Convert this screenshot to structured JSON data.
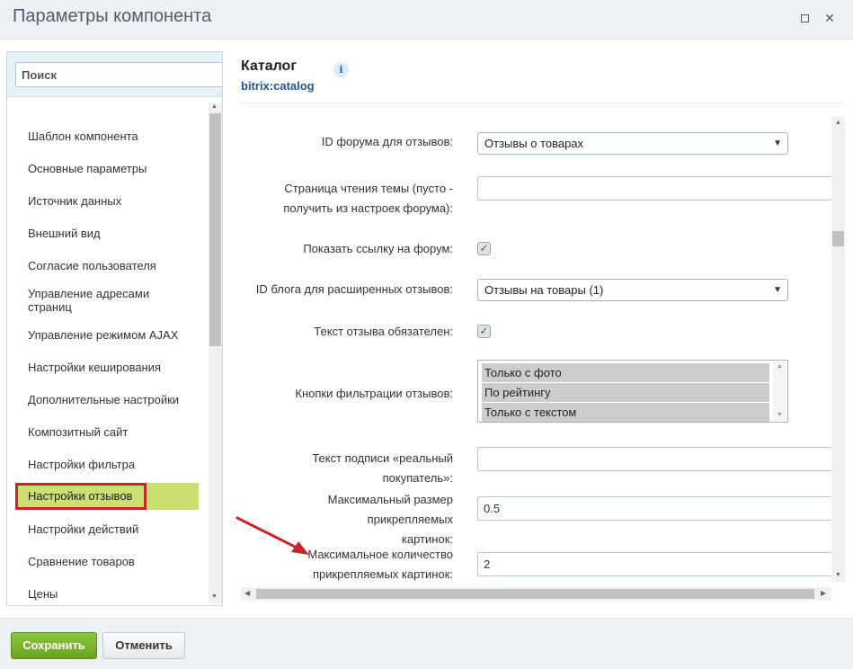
{
  "window": {
    "title": "Параметры компонента",
    "maximize_icon": "maximize-icon",
    "close_icon": "close-icon",
    "close_glyph": "✕"
  },
  "sidebar": {
    "search_placeholder": "Поиск",
    "items": [
      {
        "label": "Шаблон компонента"
      },
      {
        "label": "Основные параметры"
      },
      {
        "label": "Источник данных"
      },
      {
        "label": "Внешний вид"
      },
      {
        "label": "Согласие пользователя"
      },
      {
        "label": "Управление адресами страниц"
      },
      {
        "label": "Управление режимом AJAX"
      },
      {
        "label": "Настройки кеширования"
      },
      {
        "label": "Дополнительные настройки"
      },
      {
        "label": "Композитный сайт"
      },
      {
        "label": "Настройки фильтра"
      },
      {
        "label": "Настройки отзывов"
      },
      {
        "label": "Настройки действий"
      },
      {
        "label": "Сравнение товаров"
      },
      {
        "label": "Цены"
      }
    ],
    "active_index": 11
  },
  "component": {
    "title": "Каталог",
    "code": "bitrix:catalog",
    "info_glyph": "i"
  },
  "form": {
    "forum_id": {
      "label": "ID форума для отзывов:",
      "value": "Отзывы о товарах"
    },
    "topic_page": {
      "label_line1": "Страница чтения темы (пусто -",
      "label_line2": "получить из настроек форума):",
      "value": ""
    },
    "show_forum_link": {
      "label": "Показать ссылку на форум:",
      "checked": true
    },
    "blog_id": {
      "label": "ID блога для расширенных отзывов:",
      "value": "Отзывы на товары (1)"
    },
    "text_required": {
      "label": "Текст отзыва обязателен:",
      "checked": true
    },
    "filter_buttons": {
      "label": "Кнопки фильтрации отзывов:",
      "options": [
        "Только с фото",
        "По рейтингу",
        "Только с текстом"
      ]
    },
    "buyer_caption": {
      "label": "Текст подписи «реальный покупатель»:",
      "value": ""
    },
    "max_image_size": {
      "label_line1": "Максимальный размер прикрепляемых",
      "label_line2": "картинок:",
      "value": "0.5"
    },
    "max_image_count": {
      "label_line1": "Максимальное количество",
      "label_line2": "прикрепляемых картинок:",
      "value": "2"
    }
  },
  "footer": {
    "save_label": "Сохранить",
    "cancel_label": "Отменить"
  },
  "colors": {
    "save_button": "#7ab530",
    "active_item_bg": "#cbdf73",
    "highlight_border": "#c7262a",
    "annotation_arrow": "#c7262a"
  }
}
